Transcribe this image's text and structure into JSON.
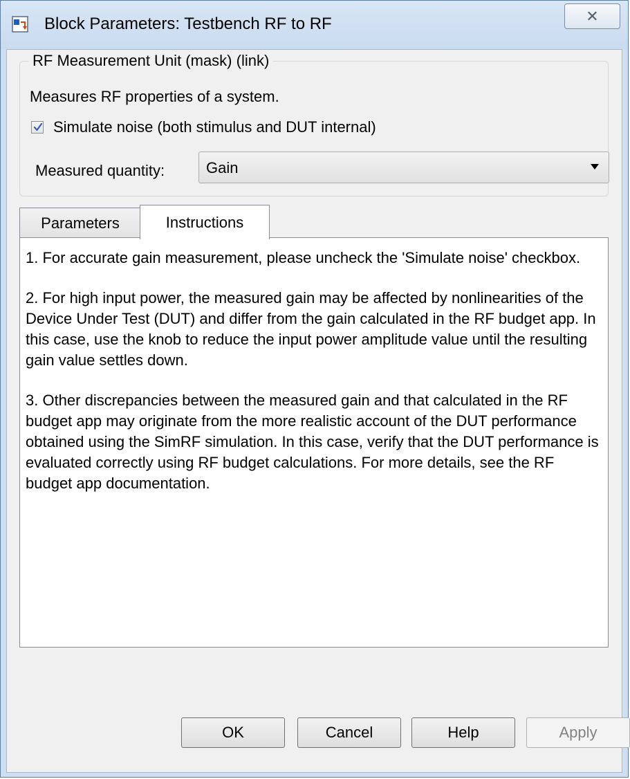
{
  "window": {
    "title": "Block Parameters: Testbench RF to RF",
    "close_glyph": "✕",
    "app_icon": "simulink-block-icon"
  },
  "mask": {
    "title": "RF Measurement Unit (mask) (link)",
    "description": "Measures RF properties of a system.",
    "simulate_noise": {
      "label": "Simulate noise (both stimulus and DUT internal)",
      "checked": true
    },
    "measured_quantity": {
      "label": "Measured quantity:",
      "value": "Gain"
    }
  },
  "tabs": [
    {
      "label": "Parameters",
      "active": false
    },
    {
      "label": "Instructions",
      "active": true
    }
  ],
  "instructions": [
    "1. For accurate gain measurement, please uncheck the 'Simulate noise' checkbox.",
    "2. For high input power, the measured gain may be affected by nonlinearities of the Device Under Test (DUT) and differ from the gain calculated in the RF budget app. In this case, use the knob to reduce the input power amplitude value until the resulting gain value settles down.",
    "3. Other discrepancies between the measured gain and that calculated in the RF budget app may originate from the more realistic account of the DUT performance obtained using the SimRF simulation. In this case, verify that the DUT performance is evaluated correctly using RF budget calculations. For more details, see the RF budget app documentation."
  ],
  "buttons": {
    "ok": "OK",
    "cancel": "Cancel",
    "help": "Help",
    "apply": "Apply"
  },
  "colors": {
    "checkmark": "#3a5fa8",
    "window_border": "#5d7d9e",
    "titlebar": "#cfdef0",
    "disabled_text": "#838383"
  }
}
